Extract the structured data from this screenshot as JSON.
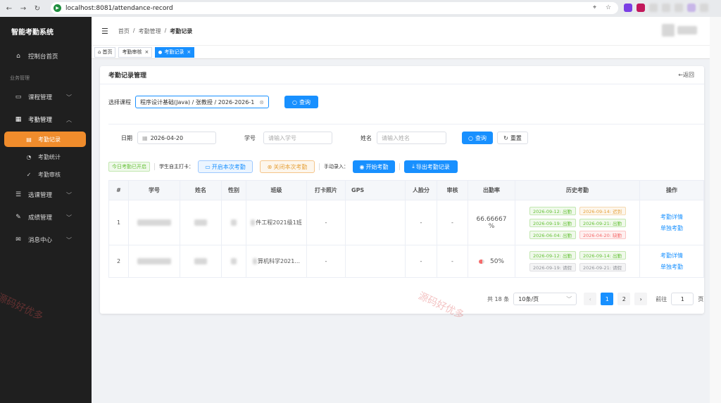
{
  "browser": {
    "url": "localhost:8081/attendance-record",
    "back": "←",
    "forward": "→",
    "reload": "↻"
  },
  "sidebar": {
    "logo": "智能考勤系统",
    "dashboard": "控制台首页",
    "group": "业务管理",
    "items": [
      {
        "label": "课程管理"
      },
      {
        "label": "考勤管理"
      },
      {
        "label": "选课管理"
      },
      {
        "label": "成绩管理"
      },
      {
        "label": "消息中心"
      }
    ],
    "sub": [
      {
        "label": "考勤记录"
      },
      {
        "label": "考勤统计"
      },
      {
        "label": "考勤审核"
      }
    ]
  },
  "header": {
    "breadcrumb": [
      "首页",
      "考勤管理",
      "考勤记录"
    ],
    "sep": "/"
  },
  "tags": [
    {
      "label": "首页"
    },
    {
      "label": "考勤审核"
    },
    {
      "label": "考勤记录"
    }
  ],
  "card": {
    "title": "考勤记录管理",
    "back": "←返回"
  },
  "course": {
    "label": "选择课程",
    "value": "程序设计基础(Java) / 张教授 / 2026-2026-1",
    "query": "查询"
  },
  "filter": {
    "date_label": "日期",
    "date_value": "2026-04-20",
    "sid_label": "学号",
    "sid_placeholder": "请输入学号",
    "name_label": "姓名",
    "name_placeholder": "请输入姓名",
    "query": "查询",
    "reset": "重置"
  },
  "actions": {
    "status": "今日考勤已开启",
    "self_label": "学生自主打卡：",
    "open": "开启本次考勤",
    "close": "关闭本次考勤",
    "manual_label": "手动录入：",
    "start": "开始考勤",
    "export": "导出考勤记录"
  },
  "table": {
    "headers": [
      "#",
      "学号",
      "姓名",
      "性别",
      "班级",
      "打卡照片",
      "GPS",
      "人脸分",
      "审核",
      "出勤率",
      "历史考勤",
      "操作"
    ],
    "rows": [
      {
        "index": "1",
        "class": "件工程2021级1班",
        "photo": "-",
        "gps": "",
        "face": "-",
        "review": "-",
        "rate": "66.66667 %",
        "history": [
          {
            "text": "2026-09-12: 出勤",
            "status": "ok"
          },
          {
            "text": "2026-09-14: 迟到",
            "status": "late"
          },
          {
            "text": "2026-09-19: 出勤",
            "status": "ok"
          },
          {
            "text": "2026-09-21: 出勤",
            "status": "ok"
          },
          {
            "text": "2026-06-04: 出勤",
            "status": "ok"
          },
          {
            "text": "2026-04-20: 缺勤",
            "status": "absent"
          }
        ],
        "op1": "考勤详情",
        "op2": "单独考勤"
      },
      {
        "index": "2",
        "class": "算机科学2021...",
        "photo": "-",
        "gps": "",
        "face": "-",
        "review": "-",
        "rate": "50%",
        "history": [
          {
            "text": "2026-09-12: 出勤",
            "status": "ok"
          },
          {
            "text": "2026-09-14: 出勤",
            "status": "ok"
          },
          {
            "text": "2026-09-19: 请假",
            "status": "leave"
          },
          {
            "text": "2026-09-21: 请假",
            "status": "leave"
          }
        ],
        "op1": "考勤详情",
        "op2": "单独考勤"
      }
    ]
  },
  "pager": {
    "total": "共 18 条",
    "size": "10条/页",
    "prev": "‹",
    "next": "›",
    "pages": [
      "1",
      "2"
    ],
    "goto": "前往",
    "goto_value": "1",
    "page_unit": "页"
  },
  "watermark": "源码好优多",
  "colors": {
    "primary": "#1890ff",
    "active_menu": "#f08c2c",
    "sidebar": "#1f1f1f"
  }
}
